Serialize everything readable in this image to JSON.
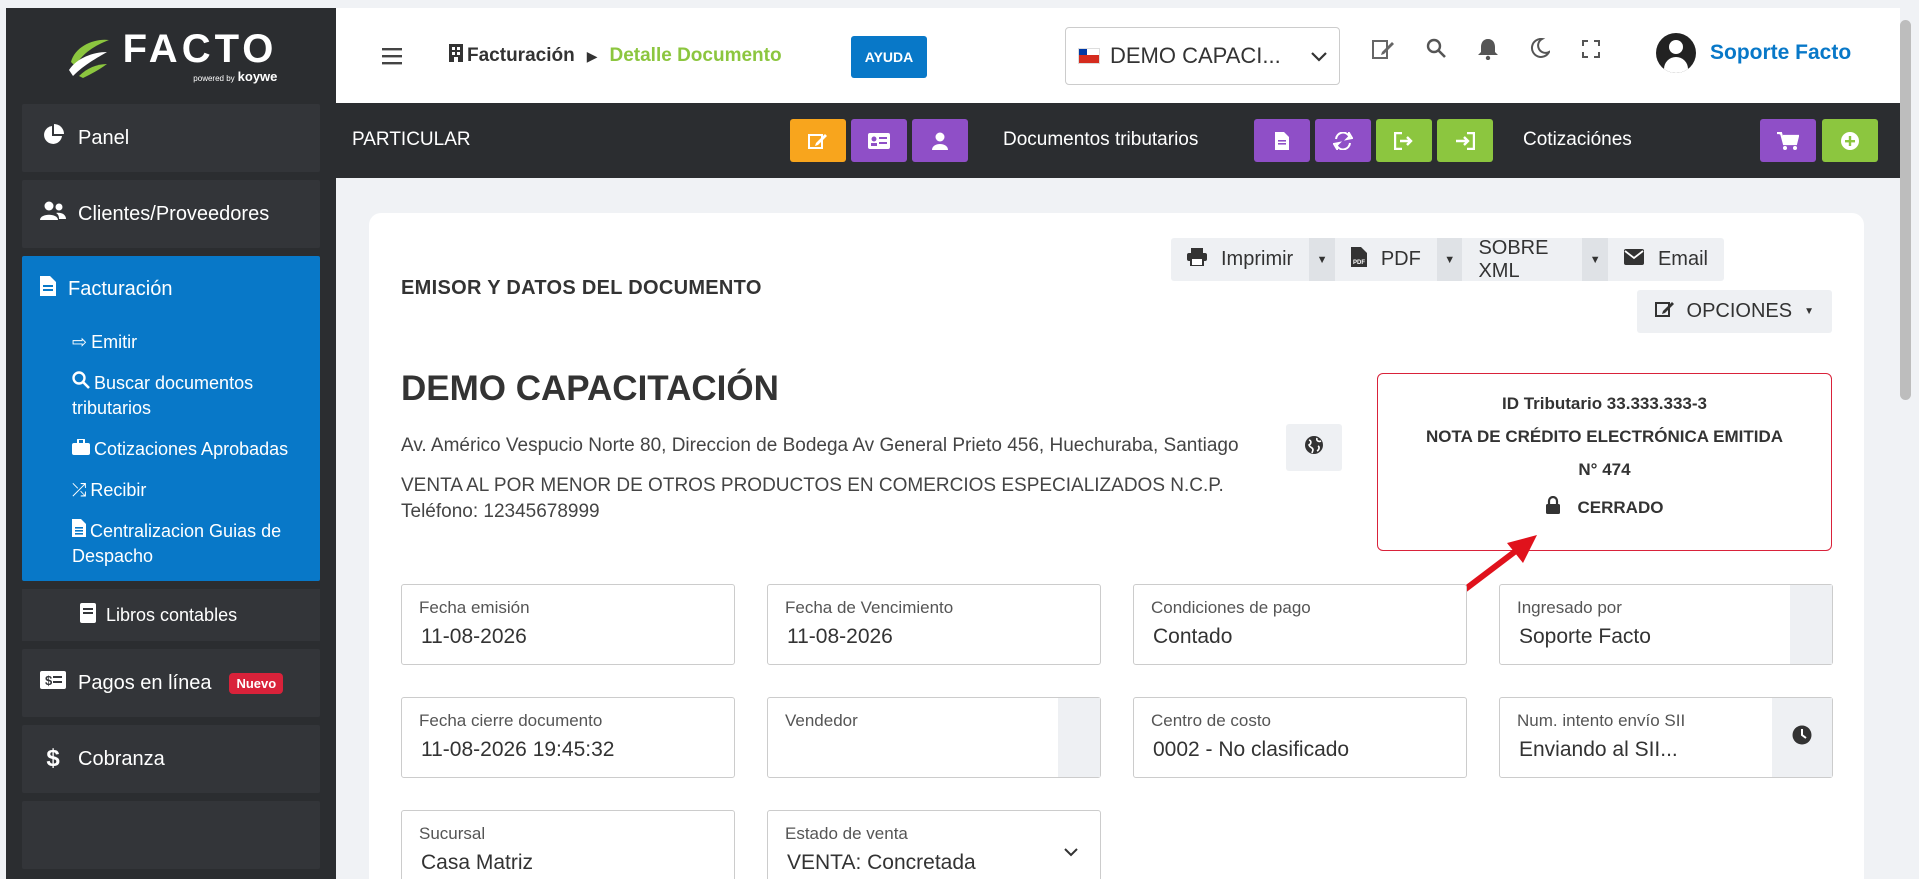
{
  "brand": {
    "name": "FACTO",
    "powered": "powered by",
    "by": "koywe"
  },
  "sidebar": {
    "items": [
      {
        "label": "Panel",
        "icon": "pie-chart-icon"
      },
      {
        "label": "Clientes/Proveedores",
        "icon": "users-icon"
      }
    ],
    "group": {
      "label": "Facturación",
      "icon": "document-icon",
      "subitems": [
        {
          "label": "Emitir",
          "icon": "sign-out-icon"
        },
        {
          "label": "Buscar documentos tributarios",
          "icon": "search-icon"
        },
        {
          "label": "Cotizaciones Aprobadas",
          "icon": "briefcase-icon"
        },
        {
          "label": "Recibir",
          "icon": "shuffle-icon"
        },
        {
          "label": "Centralizacion Guias de Despacho",
          "icon": "file-icon"
        }
      ],
      "libros": "Libros contables"
    },
    "pagos": {
      "label": "Pagos en línea",
      "badge": "Nuevo"
    },
    "cobranza": {
      "label": "Cobranza"
    }
  },
  "header": {
    "breadcrumb_first": "Facturación",
    "breadcrumb_second": "Detalle Documento",
    "help": "AYUDA",
    "company": "DEMO CAPACI...",
    "user": "Soporte Facto"
  },
  "toolbar": {
    "particular": "PARTICULAR",
    "docs": "Documentos tributarios",
    "cotizaciones": "Cotizaciónes"
  },
  "card": {
    "section_title": "EMISOR Y DATOS DEL DOCUMENTO",
    "actions": {
      "print": "Imprimir",
      "pdf": "PDF",
      "xml": "SOBRE XML",
      "email": "Email",
      "options": "OPCIONES"
    },
    "company_name": "DEMO CAPACITACIÓN",
    "address": "Av. Américo Vespucio Norte 80, Direccion de Bodega Av General Prieto 456, Huechuraba, Santiago",
    "giro": "VENTA AL POR MENOR DE OTROS PRODUCTOS EN COMERCIOS ESPECIALIZADOS N.C.P.",
    "phone": "Teléfono: 12345678999",
    "docbox": {
      "id": "ID Tributario 33.333.333-3",
      "type": "NOTA DE CRÉDITO ELECTRÓNICA EMITIDA",
      "number": "N° 474",
      "status": "CERRADO"
    },
    "fields": {
      "fecha_emision": {
        "label": "Fecha emisión",
        "value": "11-08-2026"
      },
      "fecha_venc": {
        "label": "Fecha de Vencimiento",
        "value": "11-08-2026"
      },
      "condiciones": {
        "label": "Condiciones de pago",
        "value": "Contado"
      },
      "ingresado": {
        "label": "Ingresado por",
        "value": "Soporte Facto"
      },
      "fecha_cierre": {
        "label": "Fecha cierre documento",
        "value": "11-08-2026 19:45:32"
      },
      "vendedor": {
        "label": "Vendedor",
        "value": ""
      },
      "centro": {
        "label": "Centro de costo",
        "value": "0002 - No clasificado"
      },
      "intento": {
        "label": "Num. intento envío SII",
        "value": "Enviando al SII..."
      },
      "sucursal": {
        "label": "Sucursal",
        "value": "Casa Matriz"
      },
      "estado": {
        "label": "Estado de venta",
        "value": "VENTA: Concretada"
      }
    }
  }
}
